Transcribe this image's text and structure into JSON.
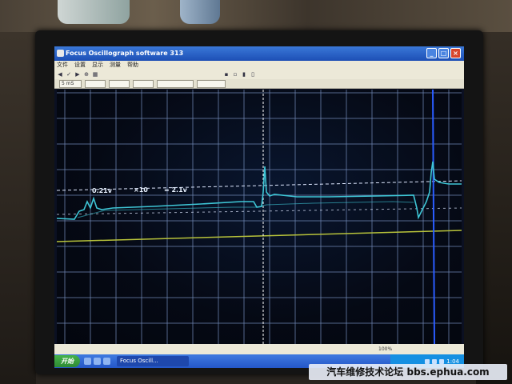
{
  "window": {
    "title": "Focus Oscillograph software 313",
    "buttons": {
      "minimize": "_",
      "maximize": "□",
      "close": "×"
    }
  },
  "menu": {
    "items": [
      "文件",
      "设置",
      "显示",
      "测量",
      "帮助"
    ]
  },
  "toolbar": {
    "fields": [
      "5 mS",
      "",
      "",
      "",
      "",
      ""
    ]
  },
  "scope": {
    "labels": {
      "voltage_low": "0.21v",
      "multiplier": "×10",
      "voltage_high": "= 2.1v"
    },
    "colors": {
      "grid": "#6f86b3",
      "trace": "#3ec6d6",
      "reference": "#b7c23a",
      "cursor": "#2a5cff"
    }
  },
  "statusbar": {
    "zoom": "100%"
  },
  "taskbar": {
    "start_label": "开始",
    "app_label": "Focus Oscill...",
    "clock": "1:04"
  },
  "watermark": {
    "text": "汽车维修技术论坛 bbs.ephua.com"
  }
}
